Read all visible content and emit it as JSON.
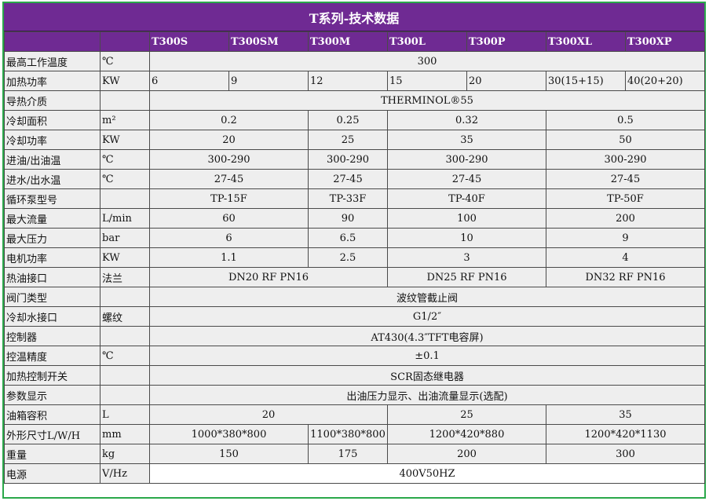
{
  "title": "T系列-技术数据",
  "models": [
    "T300S",
    "T300SM",
    "T300M",
    "T300L",
    "T300P",
    "T300XL",
    "T300XP"
  ],
  "rows": [
    {
      "label": "最高工作温度",
      "unit": "℃",
      "cells": [
        {
          "text": "300",
          "span": 7
        }
      ]
    },
    {
      "label": "加热功率",
      "unit": "KW",
      "cells": [
        {
          "text": "6",
          "span": 1,
          "align": "l"
        },
        {
          "text": "9",
          "span": 1,
          "align": "l"
        },
        {
          "text": "12",
          "span": 1,
          "align": "l"
        },
        {
          "text": "15",
          "span": 1,
          "align": "l"
        },
        {
          "text": "20",
          "span": 1,
          "align": "l"
        },
        {
          "text": "30(15+15)",
          "span": 1,
          "align": "l"
        },
        {
          "text": "40(20+20)",
          "span": 1,
          "align": "l"
        }
      ]
    },
    {
      "label": "导热介质",
      "unit": "",
      "cells": [
        {
          "text": "THERMINOL®55",
          "span": 7
        }
      ]
    },
    {
      "label": "冷却面积",
      "unit": "m²",
      "cells": [
        {
          "text": "0.2",
          "span": 2
        },
        {
          "text": "0.25",
          "span": 1
        },
        {
          "text": "0.32",
          "span": 2
        },
        {
          "text": "0.5",
          "span": 2
        }
      ]
    },
    {
      "label": "冷却功率",
      "unit": "KW",
      "cells": [
        {
          "text": "20",
          "span": 2
        },
        {
          "text": "25",
          "span": 1
        },
        {
          "text": "35",
          "span": 2
        },
        {
          "text": "50",
          "span": 2
        }
      ]
    },
    {
      "label": "进油/出油温",
      "unit": "℃",
      "cells": [
        {
          "text": "300-290",
          "span": 2
        },
        {
          "text": "300-290",
          "span": 1
        },
        {
          "text": "300-290",
          "span": 2
        },
        {
          "text": "300-290",
          "span": 2
        }
      ]
    },
    {
      "label": "进水/出水温",
      "unit": "℃",
      "cells": [
        {
          "text": "27-45",
          "span": 2
        },
        {
          "text": "27-45",
          "span": 1
        },
        {
          "text": "27-45",
          "span": 2
        },
        {
          "text": "27-45",
          "span": 2
        }
      ]
    },
    {
      "label": "循环泵型号",
      "unit": "",
      "cells": [
        {
          "text": "TP-15F",
          "span": 2
        },
        {
          "text": "TP-33F",
          "span": 1
        },
        {
          "text": "TP-40F",
          "span": 2
        },
        {
          "text": "TP-50F",
          "span": 2
        }
      ]
    },
    {
      "label": "最大流量",
      "unit": "L/min",
      "cells": [
        {
          "text": "60",
          "span": 2
        },
        {
          "text": "90",
          "span": 1
        },
        {
          "text": "100",
          "span": 2
        },
        {
          "text": "200",
          "span": 2
        }
      ]
    },
    {
      "label": "最大压力",
      "unit": "bar",
      "cells": [
        {
          "text": "6",
          "span": 2
        },
        {
          "text": "6.5",
          "span": 1
        },
        {
          "text": "10",
          "span": 2
        },
        {
          "text": "9",
          "span": 2
        }
      ]
    },
    {
      "label": "电机功率",
      "unit": "KW",
      "cells": [
        {
          "text": "1.1",
          "span": 2
        },
        {
          "text": "2.5",
          "span": 1
        },
        {
          "text": "3",
          "span": 2
        },
        {
          "text": "4",
          "span": 2
        }
      ]
    },
    {
      "label": "热油接口",
      "unit": "法兰",
      "cells": [
        {
          "text": "DN20 RF PN16",
          "span": 3
        },
        {
          "text": "DN25 RF PN16",
          "span": 2
        },
        {
          "text": "DN32 RF PN16",
          "span": 2
        }
      ]
    },
    {
      "label": "阀门类型",
      "unit": "",
      "cells": [
        {
          "text": "波纹管截止阀",
          "span": 7
        }
      ]
    },
    {
      "label": "冷却水接口",
      "unit": "螺纹",
      "cells": [
        {
          "text": "G1/2″",
          "span": 7
        }
      ]
    },
    {
      "label": "控制器",
      "unit": "",
      "cells": [
        {
          "text": "AT430(4.3″TFT电容屏)",
          "span": 7
        }
      ]
    },
    {
      "label": "控温精度",
      "unit": "℃",
      "cells": [
        {
          "text": "±0.1",
          "span": 7
        }
      ]
    },
    {
      "label": "加热控制开关",
      "unit": "",
      "cells": [
        {
          "text": "SCR固态继电器",
          "span": 7
        }
      ]
    },
    {
      "label": "参数显示",
      "unit": "",
      "cells": [
        {
          "text": "出油压力显示、出油流量显示(选配)",
          "span": 7
        }
      ]
    },
    {
      "label": "油箱容积",
      "unit": "L",
      "cells": [
        {
          "text": "20",
          "span": 3
        },
        {
          "text": "25",
          "span": 2
        },
        {
          "text": "35",
          "span": 2
        }
      ]
    },
    {
      "label": "外形尺寸L/W/H",
      "unit": "mm",
      "cells": [
        {
          "text": "1000*380*800",
          "span": 2
        },
        {
          "text": "1100*380*800",
          "span": 1
        },
        {
          "text": "1200*420*880",
          "span": 2
        },
        {
          "text": "1200*420*1130",
          "span": 2
        }
      ]
    },
    {
      "label": "重量",
      "unit": "kg",
      "cells": [
        {
          "text": "150",
          "span": 2
        },
        {
          "text": "175",
          "span": 1
        },
        {
          "text": "200",
          "span": 2
        },
        {
          "text": "300",
          "span": 2
        }
      ]
    },
    {
      "label": "电源",
      "unit": "V/Hz",
      "cells": [
        {
          "text": "400V50HZ",
          "span": 7
        }
      ]
    }
  ]
}
